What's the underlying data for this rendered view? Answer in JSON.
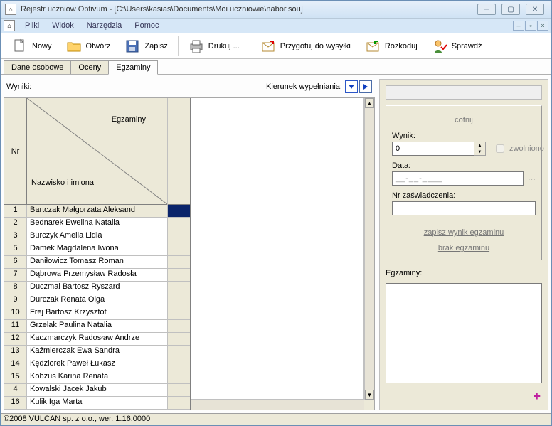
{
  "window": {
    "title": "Rejestr uczniów Optivum - [C:\\Users\\kasias\\Documents\\Moi uczniowie\\nabor.sou]"
  },
  "menu": {
    "items": [
      "Pliki",
      "Widok",
      "Narzędzia",
      "Pomoc"
    ]
  },
  "toolbar": {
    "nowy": "Nowy",
    "otworz": "Otwórz",
    "zapisz": "Zapisz",
    "drukuj": "Drukuj ...",
    "przygotuj": "Przygotuj do wysyłki",
    "rozkoduj": "Rozkoduj",
    "sprawdz": "Sprawdź"
  },
  "tabs": {
    "dane": "Dane osobowe",
    "oceny": "Oceny",
    "egzaminy": "Egzaminy"
  },
  "left": {
    "wyniki": "Wyniki:",
    "kierunek": "Kierunek wypełniania:",
    "head_nr": "Nr",
    "head_top": "Egzaminy",
    "head_bot": "Nazwisko i imiona"
  },
  "rows": [
    {
      "nr": "1",
      "name": "Bartczak Małgorzata Aleksand",
      "sel": true
    },
    {
      "nr": "2",
      "name": "Bednarek Ewelina Natalia"
    },
    {
      "nr": "3",
      "name": "Burczyk Amelia Lidia"
    },
    {
      "nr": "5",
      "name": "Damek Magdalena Iwona"
    },
    {
      "nr": "6",
      "name": "Daniłowicz Tomasz Roman"
    },
    {
      "nr": "7",
      "name": "Dąbrowa Przemysław Radosła"
    },
    {
      "nr": "8",
      "name": "Duczmal Bartosz Ryszard"
    },
    {
      "nr": "9",
      "name": "Durczak Renata Olga"
    },
    {
      "nr": "10",
      "name": "Frej Bartosz Krzysztof"
    },
    {
      "nr": "11",
      "name": "Grzelak Paulina Natalia"
    },
    {
      "nr": "12",
      "name": "Kaczmarczyk Radosław Andrze"
    },
    {
      "nr": "13",
      "name": "Kaźmierczak Ewa Sandra"
    },
    {
      "nr": "14",
      "name": "Kędziorek Paweł Łukasz"
    },
    {
      "nr": "15",
      "name": "Kobzus Karina Renata"
    },
    {
      "nr": "4",
      "name": "Kowalski Jacek Jakub"
    },
    {
      "nr": "16",
      "name": "Kulik Iga Marta"
    }
  ],
  "right": {
    "cofnij": "cofnij",
    "wynik_lbl": "Wynik:",
    "wynik_val": "0",
    "zwolniono": "zwolniono",
    "data_lbl": "Data:",
    "data_val": "__-__-____",
    "nrzasw_lbl": "Nr zaświadczenia:",
    "zapisz_link": "zapisz wynik egzaminu",
    "brak_link": "brak egzaminu",
    "egzaminy_lbl": "Egzaminy:",
    "plus": "+"
  },
  "status": "©2008 VULCAN sp. z o.o., wer. 1.16.0000"
}
